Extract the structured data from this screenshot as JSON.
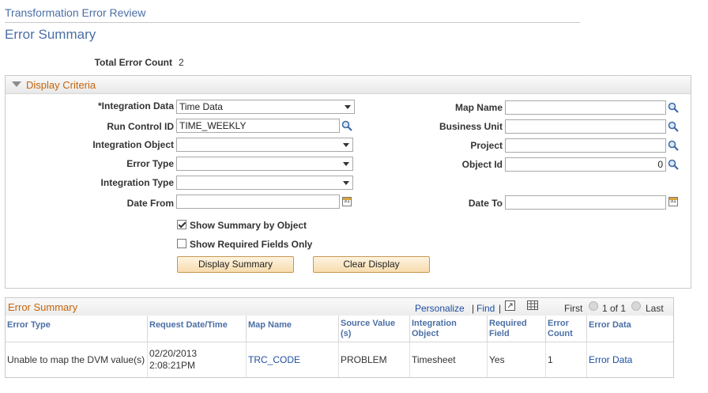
{
  "header": {
    "breadcrumb": "Transformation Error Review",
    "title": "Error Summary"
  },
  "summary": {
    "total_error_count_label": "Total Error Count",
    "total_error_count": "2"
  },
  "criteria": {
    "title": "Display Criteria",
    "integration_data_label": "*Integration Data",
    "integration_data_value": "Time Data",
    "run_control_label": "Run Control ID",
    "run_control_value": "TIME_WEEKLY",
    "integration_object_label": "Integration Object",
    "integration_object_value": "",
    "error_type_label": "Error Type",
    "error_type_value": "",
    "integration_type_label": "Integration Type",
    "integration_type_value": "",
    "date_from_label": "Date From",
    "date_from_value": "",
    "map_name_label": "Map Name",
    "map_name_value": "",
    "business_unit_label": "Business Unit",
    "business_unit_value": "",
    "project_label": "Project",
    "project_value": "",
    "object_id_label": "Object Id",
    "object_id_value": "0",
    "date_to_label": "Date To",
    "date_to_value": "",
    "show_summary_label": "Show Summary by Object",
    "show_summary_checked": true,
    "show_required_label": "Show Required Fields Only",
    "show_required_checked": false,
    "display_summary_button": "Display Summary",
    "clear_display_button": "Clear Display"
  },
  "grid": {
    "title": "Error Summary",
    "personalize": "Personalize",
    "sep1": "|",
    "find": "Find",
    "sep2": "|",
    "first": "First",
    "range": "1 of 1",
    "last": "Last",
    "columns": {
      "error_type": "Error Type",
      "request_date": "Request Date/Time",
      "map_name": "Map Name",
      "source_value": "Source Value (s)",
      "integration_object": "Integration Object",
      "required_field": "Required Field",
      "error_count": "Error Count",
      "error_data": "Error Data"
    },
    "rows": [
      {
        "error_type": "Unable to map the DVM value(s)",
        "request_date": "02/20/2013 2:08:21PM",
        "map_name": "TRC_CODE",
        "source_value": "PROBLEM",
        "integration_object": "Timesheet",
        "required_field": "Yes",
        "error_count": "1",
        "error_data": "Error Data"
      }
    ]
  },
  "icons": {
    "lookup": "magnifier-icon",
    "calendar": "calendar-icon",
    "calendar_text": "31"
  }
}
